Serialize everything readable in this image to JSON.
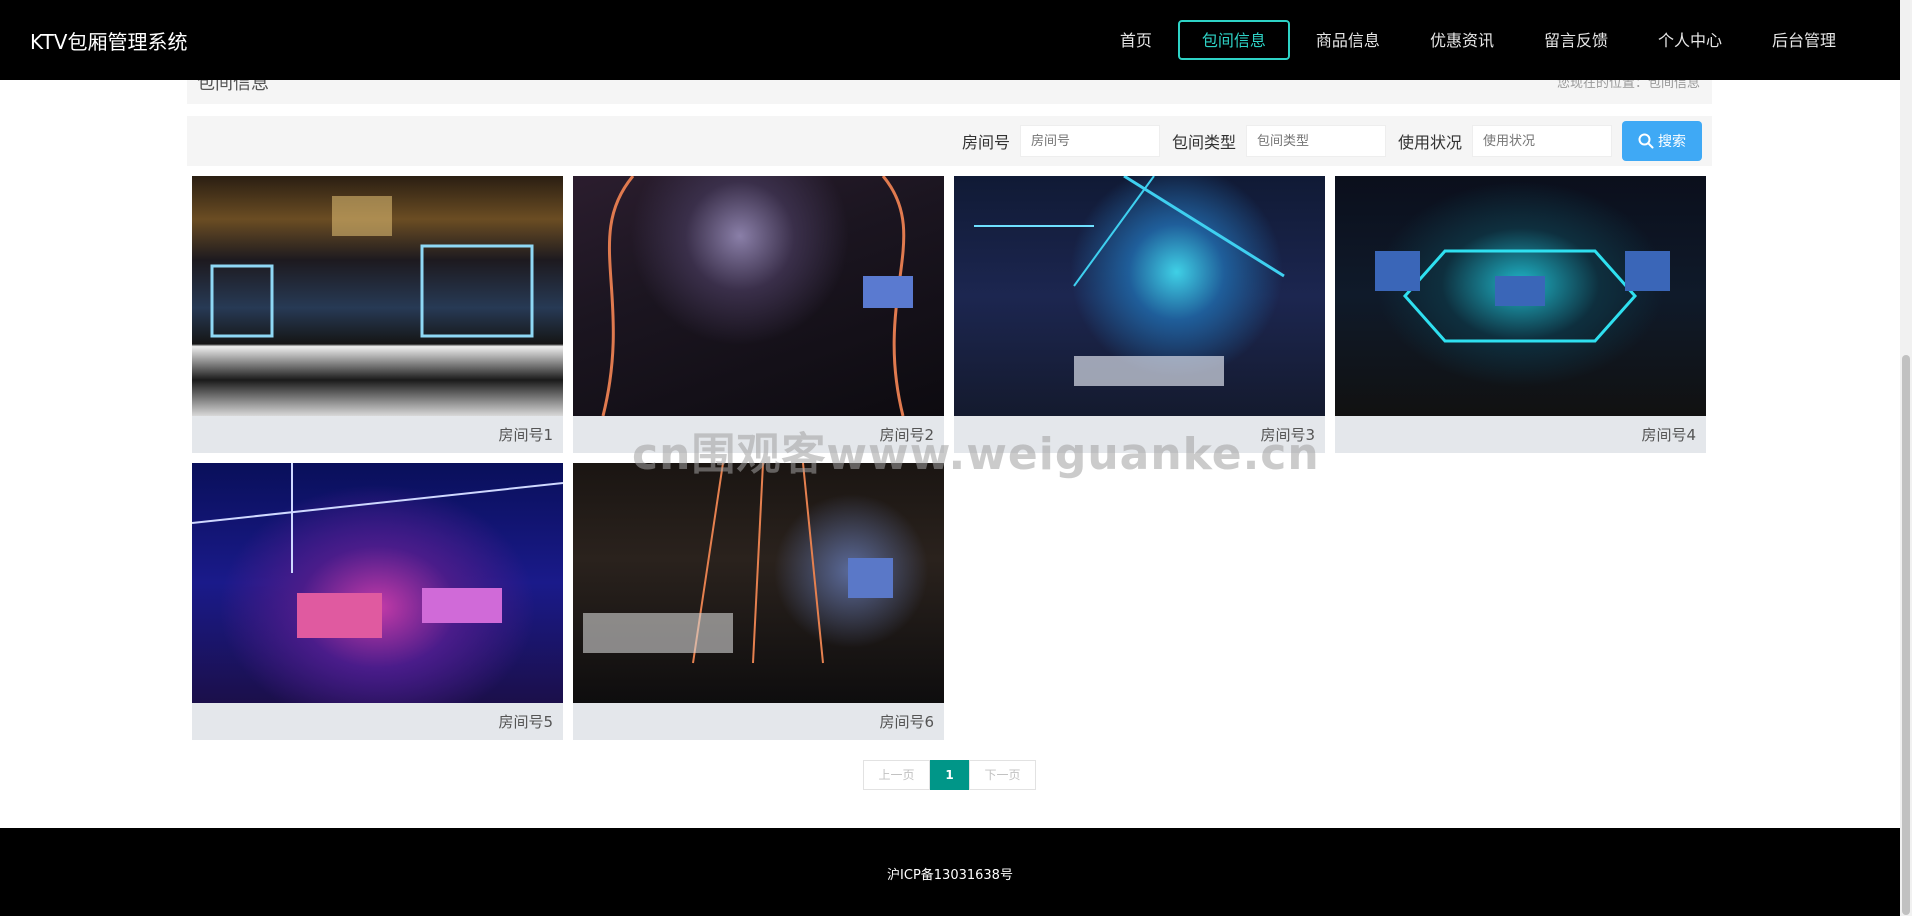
{
  "brand": "KTV包厢管理系统",
  "nav": {
    "items": [
      "首页",
      "包间信息",
      "商品信息",
      "优惠资讯",
      "留言反馈",
      "个人中心",
      "后台管理"
    ],
    "active_index": 1,
    "accent_color": "#2ed3c6"
  },
  "breadcrumb": {
    "title": "包间信息",
    "path": "您现在的位置：包间信息"
  },
  "search": {
    "fields": [
      {
        "label": "房间号",
        "placeholder": "房间号"
      },
      {
        "label": "包间类型",
        "placeholder": "包间类型"
      },
      {
        "label": "使用状况",
        "placeholder": "使用状况"
      }
    ],
    "button_label": "搜索",
    "button_color": "#3fa9f5"
  },
  "rooms": [
    {
      "caption": "房间号1",
      "image": "ktv-room-photo"
    },
    {
      "caption": "房间号2",
      "image": "ktv-room-photo"
    },
    {
      "caption": "房间号3",
      "image": "ktv-room-photo"
    },
    {
      "caption": "房间号4",
      "image": "ktv-room-photo"
    },
    {
      "caption": "房间号5",
      "image": "ktv-room-photo"
    },
    {
      "caption": "房间号6",
      "image": "ktv-room-photo"
    }
  ],
  "pagination": {
    "prev": "上一页",
    "current": "1",
    "next": "下一页",
    "active_color": "#009688"
  },
  "watermark": "cn围观客www.weiguanke.cn",
  "footer": {
    "icp": "沪ICP备13031638号"
  }
}
